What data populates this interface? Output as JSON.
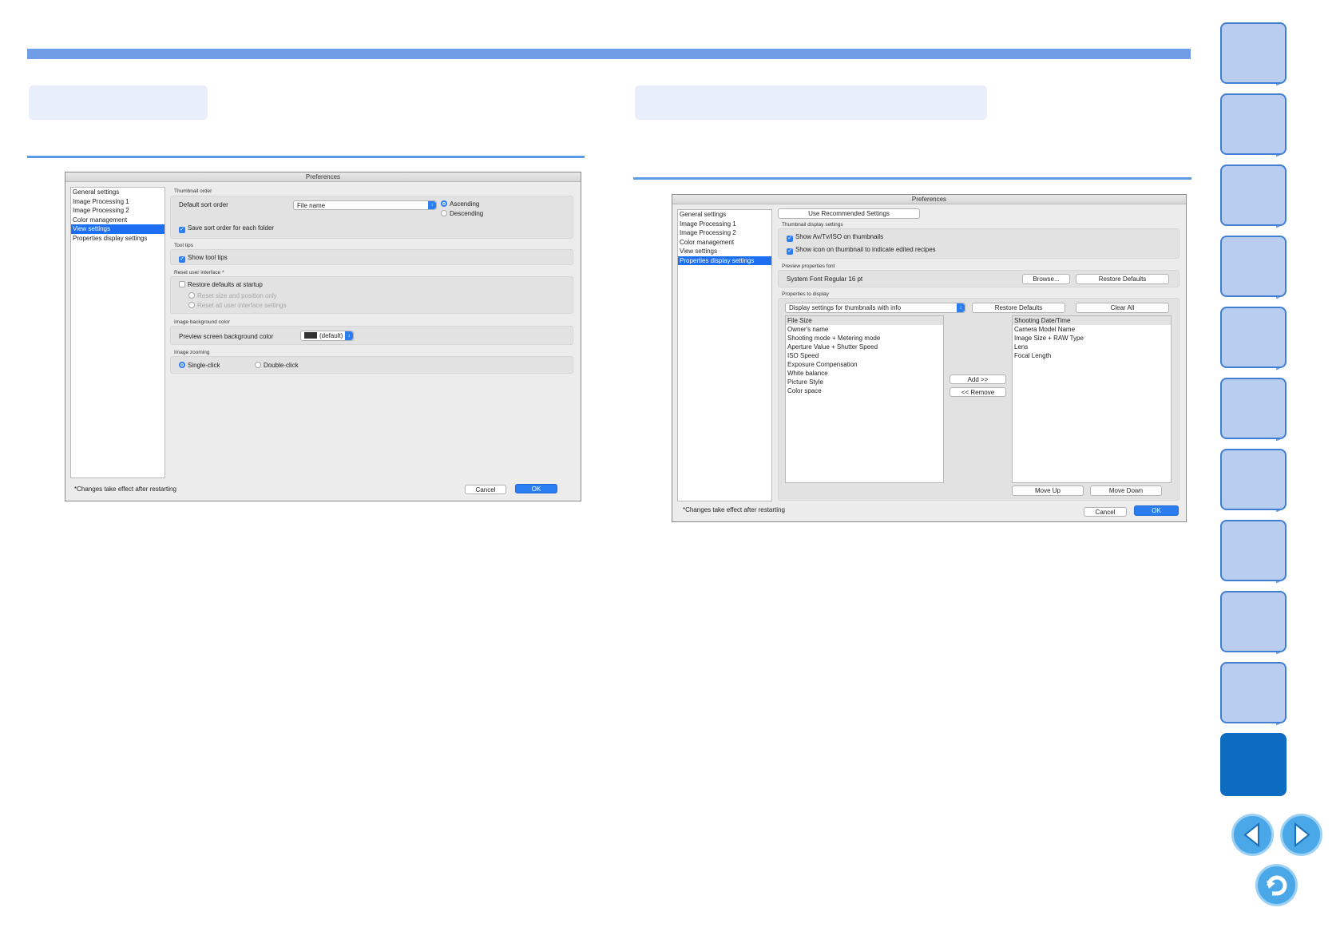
{
  "left_window": {
    "title": "Preferences",
    "sidebar": [
      "General settings",
      "Image Processing 1",
      "Image Processing 2",
      "Color management",
      "View settings",
      "Properties display settings"
    ],
    "selected_index": 4,
    "thumbnail_order": {
      "section": "Thumbnail order",
      "default_sort_label": "Default sort order",
      "sort_value": "File name",
      "ascending": "Ascending",
      "descending": "Descending",
      "save_order": "Save sort order for each folder"
    },
    "tool_tips": {
      "section": "Tool tips",
      "show": "Show tool tips"
    },
    "reset_ui": {
      "section": "Reset user interface *",
      "restore": "Restore defaults at startup",
      "opt1": "Reset size and position only",
      "opt2": "Reset all user interface settings"
    },
    "bg_color": {
      "section": "Image background color",
      "label": "Preview screen background color",
      "value": "(default)"
    },
    "zoom": {
      "section": "Image zooming",
      "single": "Single-click",
      "double": "Double-click"
    },
    "footer_note": "*Changes take effect after restarting",
    "cancel": "Cancel",
    "ok": "OK"
  },
  "right_window": {
    "title": "Preferences",
    "sidebar": [
      "General settings",
      "Image Processing 1",
      "Image Processing 2",
      "Color management",
      "View settings",
      "Properties display settings"
    ],
    "selected_index": 5,
    "use_recommended": "Use Recommended Settings",
    "thumb_display": {
      "section": "Thumbnail display settings",
      "opt1": "Show Av/Tv/ISO on thumbnails",
      "opt2": "Show icon on thumbnail to indicate edited recipes"
    },
    "preview_font": {
      "section": "Preview properties font",
      "value": "System Font Regular 16 pt",
      "browse": "Browse...",
      "restore": "Restore Defaults"
    },
    "properties": {
      "section": "Properties to display",
      "dropdown": "Display settings for thumbnails with info",
      "restore": "Restore Defaults",
      "clear": "Clear All",
      "available": [
        "File Size",
        "Owner's name",
        "Shooting mode + Metering mode",
        "Aperture Value + Shutter Speed",
        "ISO Speed",
        "Exposure Compensation",
        "White balance",
        "Picture Style",
        "Color space"
      ],
      "selected": [
        "Shooting Date/Time",
        "Camera Model Name",
        "Image Size + RAW Type",
        "Lens",
        "Focal Length"
      ],
      "add": "Add >>",
      "remove": "<< Remove",
      "move_up": "Move Up",
      "move_down": "Move Down"
    },
    "footer_note": "*Changes take effect after restarting",
    "cancel": "Cancel",
    "ok": "OK"
  },
  "colors": {
    "accent": "#2a7ef2",
    "topbar": "#6f9ee7",
    "tab": "#b8cdf0",
    "tab_active": "#0d6cc0"
  },
  "nav_icons": [
    "back-arrow-icon",
    "forward-arrow-icon",
    "return-icon"
  ]
}
